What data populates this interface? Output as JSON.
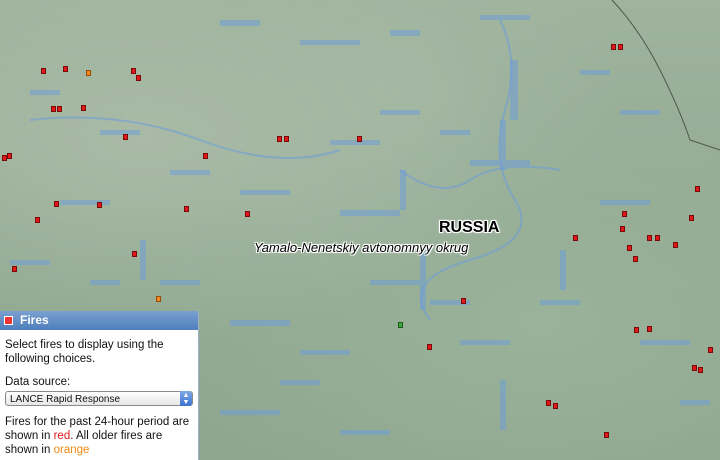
{
  "map": {
    "country_label": "RUSSIA",
    "region_label": "Yamalo-Nenetskiy avtonomnyy okrug",
    "colors": {
      "current_fire": "#e01818",
      "older_fire": "#f08a10",
      "terrain": "#9fb39d",
      "water": "#6f9fd8"
    }
  },
  "panel": {
    "title": "Fires",
    "icon": "fire-layer-icon",
    "intro": "Select fires to display using the following choices.",
    "data_source_label": "Data source:",
    "data_source_value": "LANCE Rapid Response",
    "legend_prefix": "Fires for the past 24-hour period are shown in",
    "legend_red": "red",
    "legend_middle": ". All older fires are shown in",
    "legend_orange": "orange"
  }
}
